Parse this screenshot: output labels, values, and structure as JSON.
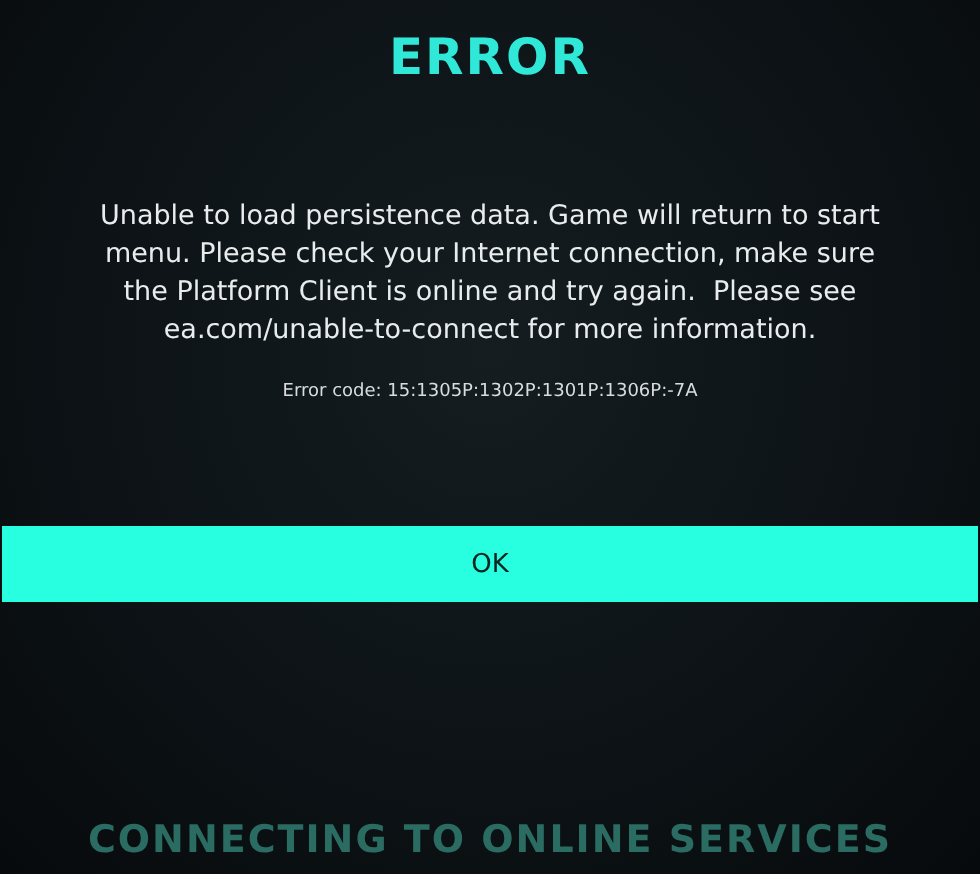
{
  "dialog": {
    "title": "ERROR",
    "message": "Unable to load persistence data. Game will return to start menu. Please check your Internet connection, make sure the Platform Client is online and try again.  Please see ea.com/unable-to-connect for more information.",
    "error_code": "Error code: 15:1305P:1302P:1301P:1306P:-7A",
    "buttons": [
      "OK"
    ]
  },
  "background": {
    "status": "CONNECTING TO ONLINE SERVICES"
  }
}
